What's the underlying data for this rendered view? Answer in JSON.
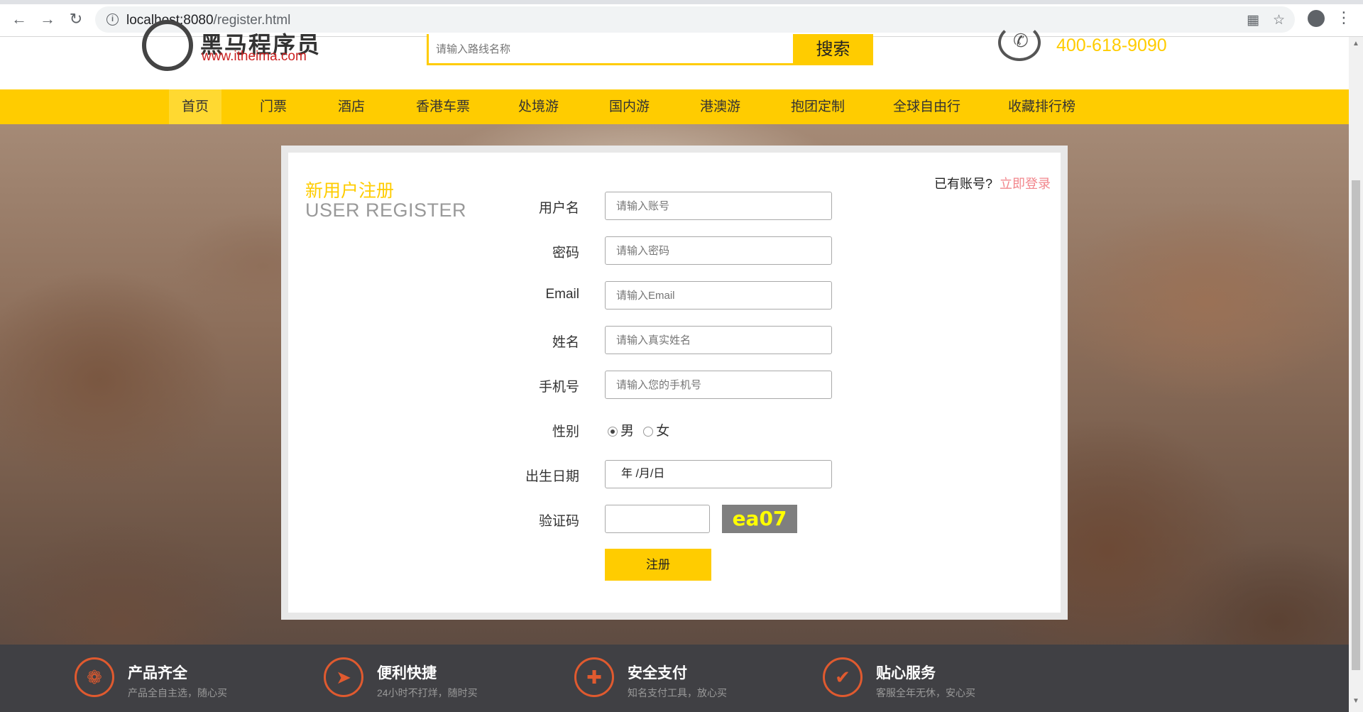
{
  "browser": {
    "url_host": "localhost:8080",
    "url_path": "/register.html",
    "icons": [
      "back-icon",
      "forward-icon",
      "reload-icon",
      "info-icon",
      "translate-icon",
      "star-icon",
      "account-icon",
      "menu-icon"
    ]
  },
  "header": {
    "logo_name": "黑马程序员",
    "logo_site": "www.itheima.com",
    "search_placeholder": "请输入路线名称",
    "search_button": "搜索",
    "hotline": "400-618-9090"
  },
  "nav": {
    "items": [
      "首页",
      "门票",
      "酒店",
      "香港车票",
      "处境游",
      "国内游",
      "港澳游",
      "抱团定制",
      "全球自由行",
      "收藏排行榜"
    ],
    "active_index": 0
  },
  "register": {
    "title_cn": "新用户注册",
    "title_en": "USER REGISTER",
    "have_account": "已有账号?",
    "login_link": "立即登录",
    "fields": {
      "username_label": "用户名",
      "username_placeholder": "请输入账号",
      "password_label": "密码",
      "password_placeholder": "请输入密码",
      "email_label": "Email",
      "email_placeholder": "请输入Email",
      "name_label": "姓名",
      "name_placeholder": "请输入真实姓名",
      "phone_label": "手机号",
      "phone_placeholder": "请输入您的手机号",
      "gender_label": "性别",
      "gender_male": "男",
      "gender_female": "女",
      "gender_selected": "男",
      "birthday_label": "出生日期",
      "birthday_value": "年 /月/日",
      "captcha_label": "验证码",
      "captcha_image_text": "ea07"
    },
    "submit_label": "注册"
  },
  "footer": {
    "features": [
      {
        "title": "产品齐全",
        "desc": "产品全自主选，随心买",
        "icon": "grid-icon"
      },
      {
        "title": "便利快捷",
        "desc": "24小时不打烊，随时买",
        "icon": "rocket-icon"
      },
      {
        "title": "安全支付",
        "desc": "知名支付工具，放心买",
        "icon": "shield-icon"
      },
      {
        "title": "贴心服务",
        "desc": "客服全年无休，安心买",
        "icon": "thumbs-up-icon"
      }
    ]
  },
  "colors": {
    "accent": "#ffcc00",
    "login_link": "#f2868c",
    "footer_bg": "#404044",
    "footer_icon": "#e05a2f"
  }
}
